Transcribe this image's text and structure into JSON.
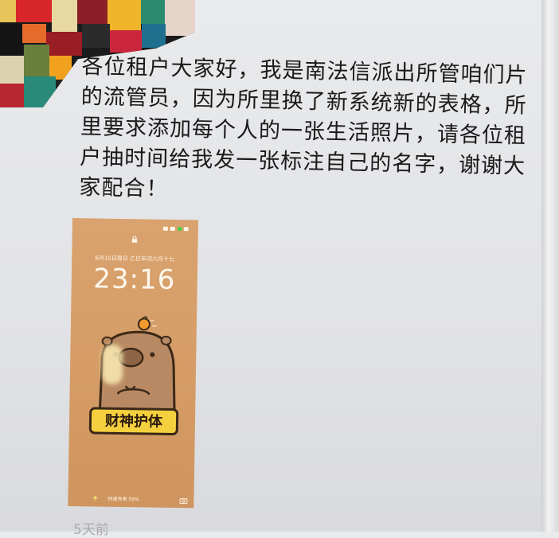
{
  "post": {
    "message": "各位租户大家好，我是南法信派出所管咱们片的流管员，因为所里换了新系统新的表格，所里要求添加每个人的一张生活照片，请各位租户抽时间给我发一张标注自己的名字，谢谢大家配合！",
    "timestamp": "5天前"
  },
  "lockscreen": {
    "date": "6月10日周日 乙巳年闰六月十七",
    "time": "23:16",
    "sticker_text": "财神护体",
    "battery_text": "快速充电 59%"
  },
  "colors": {
    "thumb_bg": "#d69e68",
    "sticker_bg": "#f4d03f",
    "text": "#1a1a1a"
  }
}
